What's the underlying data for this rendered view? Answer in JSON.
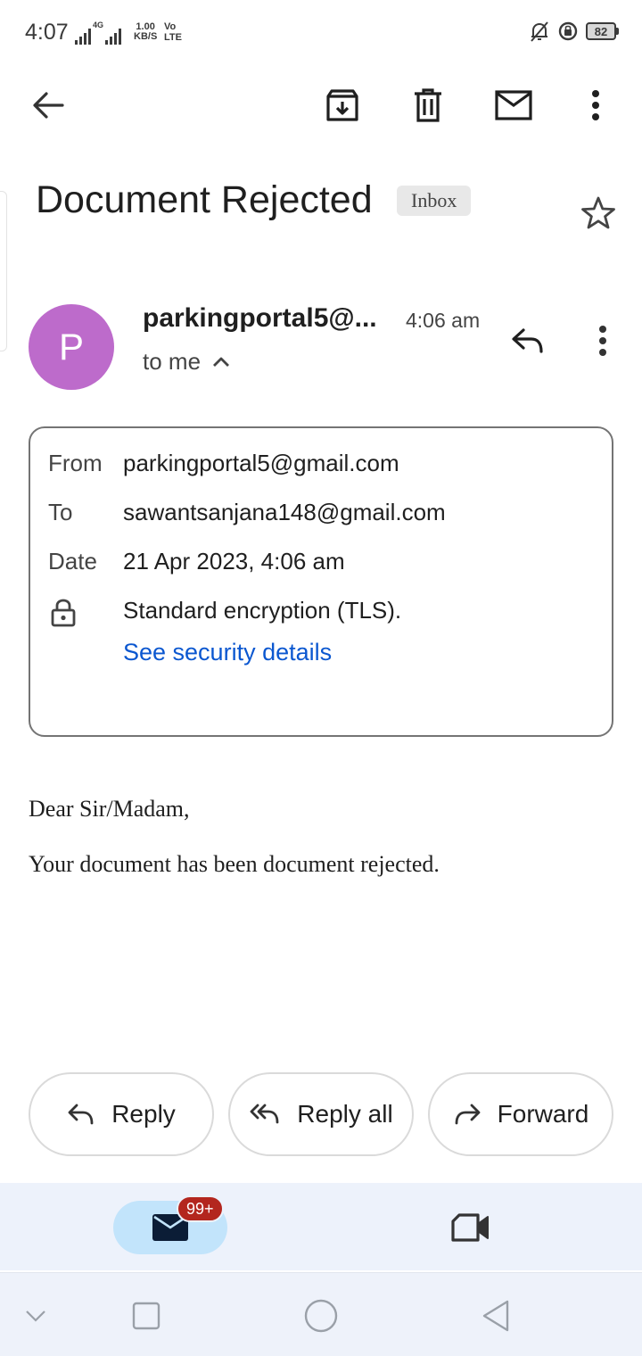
{
  "status_bar": {
    "time": "4:07",
    "network_label": "4G",
    "speed_value": "1.00",
    "speed_unit": "KB/S",
    "volte_top": "Vo",
    "volte_bottom": "LTE",
    "battery_level": "82"
  },
  "toolbar": {
    "back_icon": "arrow-left-icon",
    "archive_icon": "archive-icon",
    "delete_icon": "trash-icon",
    "mark_unread_icon": "envelope-icon",
    "more_icon": "more-vertical-icon"
  },
  "email": {
    "subject": "Document Rejected",
    "label_badge": "Inbox",
    "avatar_letter": "P",
    "sender_display": "parkingportal5@...",
    "time": "4:06 am",
    "recipient_summary": "to me",
    "details": {
      "from_label": "From",
      "from_value": "parkingportal5@gmail.com",
      "to_label": "To",
      "to_value": "sawantsanjana148@gmail.com",
      "date_label": "Date",
      "date_value": "21 Apr 2023, 4:06 am",
      "encryption": "Standard encryption (TLS).",
      "security_link": "See security details"
    },
    "body": {
      "greeting": "Dear Sir/Madam,",
      "message": "Your document has been document rejected."
    }
  },
  "actions": {
    "reply": "Reply",
    "reply_all": "Reply all",
    "forward": "Forward"
  },
  "bottom_nav": {
    "mail_badge": "99+"
  },
  "colors": {
    "avatar": "#bd6bcb",
    "link": "#0b57d0",
    "badge": "#b3261e",
    "nav_active": "#c2e4fb",
    "nav_bg": "#edf2fb"
  }
}
